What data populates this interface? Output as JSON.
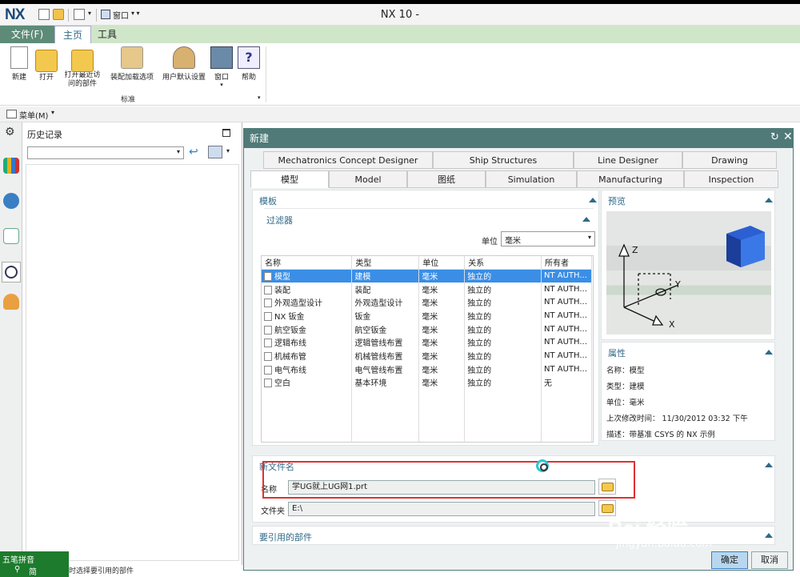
{
  "app": {
    "logo": "NX",
    "title": "NX 10 -",
    "window_menu_label": "窗口"
  },
  "menubar": {
    "file": "文件(F)",
    "home": "主页",
    "tools": "工具"
  },
  "ribbon": {
    "buttons": [
      {
        "label": "新建",
        "icon": "new-file-icon"
      },
      {
        "label": "打开",
        "icon": "open-folder-icon"
      },
      {
        "label": "打开最近访问的部件",
        "icon": "recent-folder-icon"
      },
      {
        "label": "装配加载选项",
        "icon": "assembly-load-icon"
      },
      {
        "label": "用户默认设置",
        "icon": "user-defaults-icon"
      },
      {
        "label": "窗口",
        "icon": "window-icon"
      },
      {
        "label": "帮助",
        "icon": "help-icon"
      }
    ],
    "group_label": "标准"
  },
  "menu_row": {
    "label": "菜单(M)"
  },
  "history_panel": {
    "title": "历史记录"
  },
  "dialog": {
    "title": "新建",
    "tabs_row1": [
      "Mechatronics Concept Designer",
      "Ship Structures",
      "Line Designer",
      "Drawing"
    ],
    "tabs_row2": [
      "模型",
      "Model",
      "图纸",
      "Simulation",
      "Manufacturing",
      "Inspection"
    ],
    "template_section": "模板",
    "filter_section": "过滤器",
    "unit_label": "单位",
    "unit_value": "毫米",
    "table": {
      "columns": [
        "名称",
        "类型",
        "单位",
        "关系",
        "所有者"
      ],
      "rows": [
        [
          "模型",
          "建模",
          "毫米",
          "独立的",
          "NT AUTH..."
        ],
        [
          "装配",
          "装配",
          "毫米",
          "独立的",
          "NT AUTH..."
        ],
        [
          "外观造型设计",
          "外观造型设计",
          "毫米",
          "独立的",
          "NT AUTH..."
        ],
        [
          "NX 钣金",
          "钣金",
          "毫米",
          "独立的",
          "NT AUTH..."
        ],
        [
          "航空钣金",
          "航空钣金",
          "毫米",
          "独立的",
          "NT AUTH..."
        ],
        [
          "逻辑布线",
          "逻辑管线布置",
          "毫米",
          "独立的",
          "NT AUTH..."
        ],
        [
          "机械布管",
          "机械管线布置",
          "毫米",
          "独立的",
          "NT AUTH..."
        ],
        [
          "电气布线",
          "电气管线布置",
          "毫米",
          "独立的",
          "NT AUTH..."
        ],
        [
          "空白",
          "基本环境",
          "毫米",
          "独立的",
          "无"
        ]
      ],
      "selected_row": 0
    },
    "preview_section": "预览",
    "properties_section": "属性",
    "properties": [
      "名称：模型",
      "类型：建模",
      "单位：毫米",
      "上次修改时间： 11/30/2012 03:32 下午",
      "描述：带基准 CSYS 的 NX 示例"
    ],
    "new_file_section": "新文件名",
    "name_label": "名称",
    "name_value": "学UG就上UG网1.prt",
    "folder_label": "文件夹",
    "folder_value": "E:\\",
    "ref_section": "要引用的部件",
    "ok": "确定",
    "cancel": "取消"
  },
  "ime": {
    "row1": "五笔拼音",
    "row2": "简"
  },
  "status": {
    "text": "时选择要引用的部件"
  },
  "watermark": {
    "line1": "Bai 经验",
    "line2": "jingyan.baidu.com"
  }
}
